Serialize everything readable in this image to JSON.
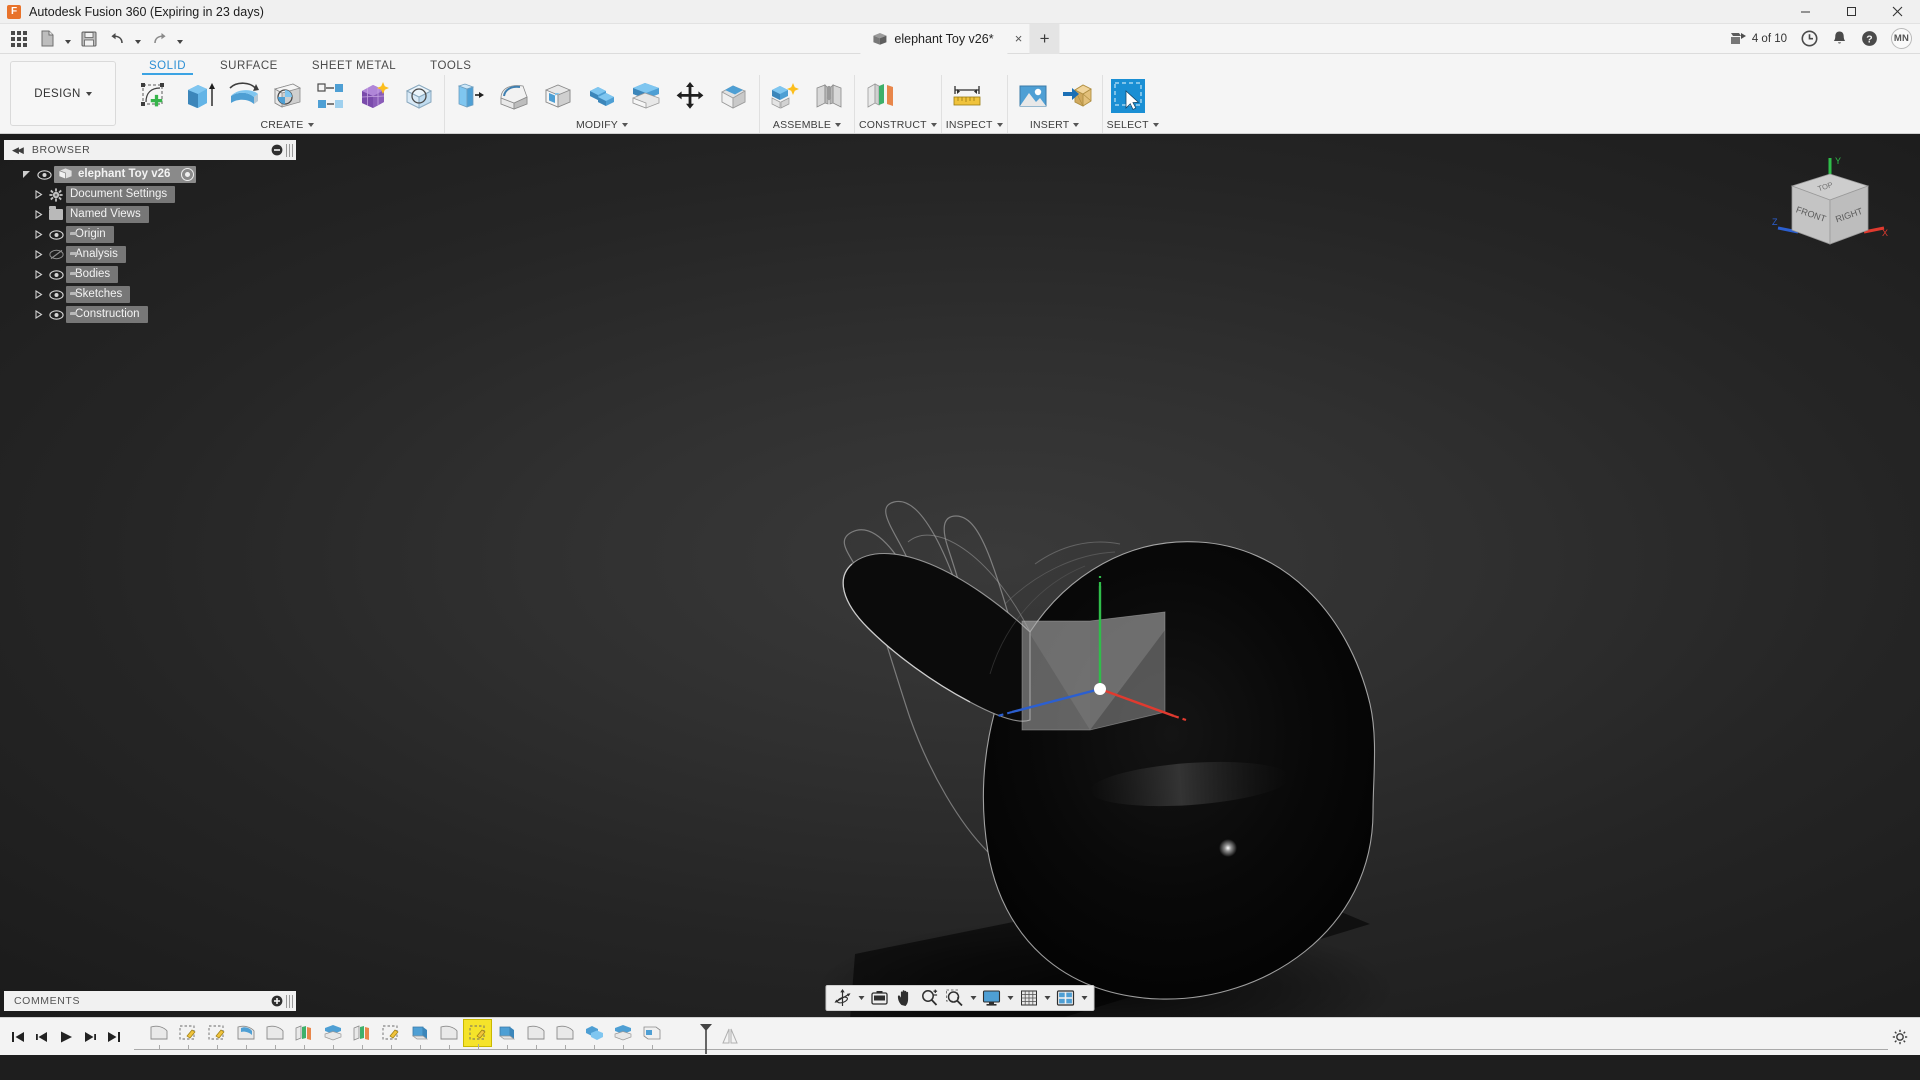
{
  "titlebar": {
    "app_title": "Autodesk Fusion 360 (Expiring in 23 days)",
    "logo_letter": "F",
    "minimize": "minimize-button",
    "maximize": "maximize-button",
    "close": "close-button"
  },
  "appbar": {
    "quick_access": [
      {
        "name": "app-grid-icon",
        "label": "Show Data Panel"
      },
      {
        "name": "new-file-icon",
        "label": "File"
      },
      {
        "name": "save-icon",
        "label": "Save"
      },
      {
        "name": "undo-icon",
        "label": "Undo"
      },
      {
        "name": "redo-icon",
        "label": "Redo"
      }
    ],
    "document_tab": {
      "title": "elephant Toy v26*",
      "close_label": "×"
    },
    "add_tab_label": "+",
    "jobs_status": "4 of 10",
    "right_icons": [
      {
        "name": "job-status-icon"
      },
      {
        "name": "recent-activity-icon"
      },
      {
        "name": "notifications-bell-icon"
      },
      {
        "name": "help-icon"
      }
    ],
    "avatar_initials": "MN"
  },
  "ribbon": {
    "design_dropdown": "DESIGN",
    "tabs": [
      {
        "label": "SOLID",
        "active": true
      },
      {
        "label": "SURFACE",
        "active": false
      },
      {
        "label": "SHEET METAL",
        "active": false
      },
      {
        "label": "TOOLS",
        "active": false
      }
    ],
    "panels": [
      {
        "label": "CREATE",
        "has_caret": true,
        "buttons": [
          {
            "name": "create-sketch-icon",
            "title": "Create Sketch"
          },
          {
            "name": "extrude-icon",
            "title": "Extrude"
          },
          {
            "name": "revolve-icon",
            "title": "Revolve"
          },
          {
            "name": "sweep-icon",
            "title": "Sweep"
          },
          {
            "name": "pattern-icon",
            "title": "Rectangular Pattern"
          },
          {
            "name": "form-icon",
            "title": "Create Form"
          },
          {
            "name": "cylinder-icon",
            "title": "Cylinder"
          }
        ]
      },
      {
        "label": "MODIFY",
        "has_caret": true,
        "buttons": [
          {
            "name": "press-pull-icon",
            "title": "Press Pull"
          },
          {
            "name": "fillet-icon",
            "title": "Fillet"
          },
          {
            "name": "shell-icon",
            "title": "Shell"
          },
          {
            "name": "combine-icon",
            "title": "Combine"
          },
          {
            "name": "offset-face-icon",
            "title": "Offset Face"
          },
          {
            "name": "move-copy-icon",
            "title": "Move/Copy"
          },
          {
            "name": "align-icon",
            "title": "Align"
          }
        ]
      },
      {
        "label": "ASSEMBLE",
        "has_caret": true,
        "buttons": [
          {
            "name": "new-component-icon",
            "title": "New Component"
          },
          {
            "name": "joint-icon",
            "title": "Joint"
          }
        ]
      },
      {
        "label": "CONSTRUCT",
        "has_caret": true,
        "buttons": [
          {
            "name": "offset-plane-icon",
            "title": "Offset Plane"
          }
        ]
      },
      {
        "label": "INSPECT",
        "has_caret": true,
        "buttons": [
          {
            "name": "measure-icon",
            "title": "Measure"
          }
        ]
      },
      {
        "label": "INSERT",
        "has_caret": true,
        "buttons": [
          {
            "name": "decal-icon",
            "title": "Decal"
          },
          {
            "name": "insert-mesh-icon",
            "title": "Insert Mesh"
          }
        ]
      },
      {
        "label": "SELECT",
        "has_caret": true,
        "buttons": [
          {
            "name": "select-icon",
            "title": "Select",
            "selected": true
          }
        ]
      }
    ]
  },
  "browser": {
    "header": "BROWSER",
    "collapse_icon": "collapse-left-icon",
    "settings_icon": "browser-options-icon",
    "tree": [
      {
        "label": "elephant Toy v26",
        "level": 0,
        "root": true,
        "has_disclosure": true,
        "expanded": true,
        "eye": "visible",
        "icon": "component-icon",
        "radio": true
      },
      {
        "label": "Document Settings",
        "level": 1,
        "has_disclosure": true,
        "expanded": false,
        "eye": "none",
        "icon": "gear-icon"
      },
      {
        "label": "Named Views",
        "level": 1,
        "has_disclosure": true,
        "expanded": false,
        "eye": "none",
        "icon": "folder-icon"
      },
      {
        "label": "Origin",
        "level": 1,
        "has_disclosure": true,
        "expanded": false,
        "eye": "visible",
        "icon": "folder-icon"
      },
      {
        "label": "Analysis",
        "level": 1,
        "has_disclosure": true,
        "expanded": false,
        "eye": "hidden",
        "icon": "folder-icon"
      },
      {
        "label": "Bodies",
        "level": 1,
        "has_disclosure": true,
        "expanded": false,
        "eye": "visible",
        "icon": "folder-icon"
      },
      {
        "label": "Sketches",
        "level": 1,
        "has_disclosure": true,
        "expanded": false,
        "eye": "visible",
        "icon": "folder-icon"
      },
      {
        "label": "Construction",
        "level": 1,
        "has_disclosure": true,
        "expanded": false,
        "eye": "visible",
        "icon": "folder-icon"
      }
    ]
  },
  "comments": {
    "label": "COMMENTS",
    "add_icon": "add-comment-icon"
  },
  "navbar": {
    "buttons": [
      {
        "name": "orbit-icon",
        "label": "Orbit",
        "caret": true
      },
      {
        "name": "look-at-icon",
        "label": "Look At",
        "caret": false
      },
      {
        "name": "pan-icon",
        "label": "Pan",
        "caret": false
      },
      {
        "name": "zoom-icon",
        "label": "Zoom",
        "caret": false
      },
      {
        "name": "zoom-window-icon",
        "label": "Fit",
        "caret": true
      },
      {
        "name": "display-settings-icon",
        "label": "Display Settings",
        "caret": true
      },
      {
        "name": "grid-snaps-icon",
        "label": "Grid and Snaps",
        "caret": true
      },
      {
        "name": "viewports-icon",
        "label": "Viewports",
        "caret": true
      }
    ]
  },
  "viewcube": {
    "face_front": "FRONT",
    "face_right": "RIGHT",
    "face_top": "TOP",
    "axis_x": "X",
    "axis_y": "Y",
    "axis_z": "Z"
  },
  "canvas": {
    "model_name": "elephant-toy-3d-model",
    "origin_axes": {
      "x_color": "#d93025",
      "y_color": "#34a853",
      "z_color": "#1a73e8"
    }
  },
  "timeline": {
    "playback": [
      {
        "name": "go-to-beginning-icon"
      },
      {
        "name": "step-back-icon"
      },
      {
        "name": "play-forward-icon"
      },
      {
        "name": "step-forward-icon"
      },
      {
        "name": "go-to-end-icon"
      }
    ],
    "features": [
      {
        "name": "sketch-feature-icon",
        "type": "sketch",
        "selected": false
      },
      {
        "name": "sketch-edit-feature-icon",
        "type": "sketch-edit",
        "selected": false
      },
      {
        "name": "sketch-edit-feature-icon",
        "type": "sketch-edit",
        "selected": false
      },
      {
        "name": "loft-feature-icon",
        "type": "loft",
        "selected": false
      },
      {
        "name": "sketch-feature-icon",
        "type": "sketch",
        "selected": false
      },
      {
        "name": "plane-feature-icon",
        "type": "plane",
        "selected": false
      },
      {
        "name": "offset-feature-icon",
        "type": "offset",
        "selected": false
      },
      {
        "name": "plane-feature-icon",
        "type": "plane",
        "selected": false
      },
      {
        "name": "sketch-edit-feature-icon",
        "type": "sketch-edit",
        "selected": false
      },
      {
        "name": "extrude-feature-icon",
        "type": "extrude",
        "selected": false
      },
      {
        "name": "sketch-feature-icon",
        "type": "sketch",
        "selected": false
      },
      {
        "name": "sketch-selected-feature-icon",
        "type": "sketch",
        "selected": true
      },
      {
        "name": "extrude-feature-icon",
        "type": "extrude",
        "selected": false
      },
      {
        "name": "sketch-feature-icon",
        "type": "sketch",
        "selected": false
      },
      {
        "name": "sketch-feature-icon",
        "type": "sketch",
        "selected": false
      },
      {
        "name": "combine-feature-icon",
        "type": "combine",
        "selected": false
      },
      {
        "name": "offset-feature-icon",
        "type": "offset",
        "selected": false
      },
      {
        "name": "shell-feature-icon",
        "type": "shell",
        "selected": false
      }
    ],
    "end_marker": "timeline-end-marker"
  }
}
